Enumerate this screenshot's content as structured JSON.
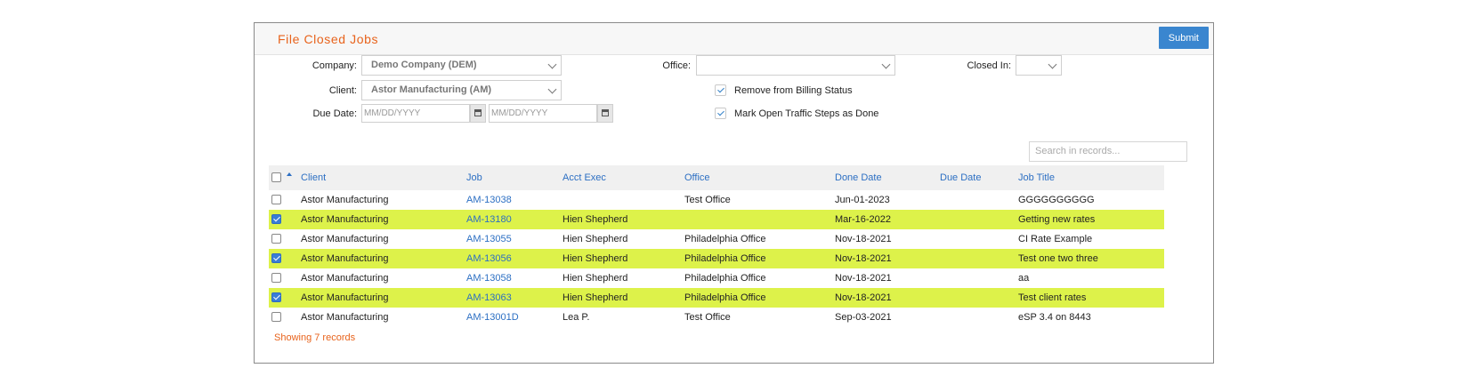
{
  "header": {
    "title": "File Closed Jobs",
    "submit_label": "Submit"
  },
  "filters": {
    "company_label": "Company:",
    "company_value": "Demo Company (DEM)",
    "client_label": "Client:",
    "client_value": "Astor Manufacturing (AM)",
    "due_date_label": "Due Date:",
    "due_from_placeholder": "MM/DD/YYYY",
    "due_to_placeholder": "MM/DD/YYYY",
    "office_label": "Office:",
    "office_value": "",
    "closed_in_label": "Closed In:",
    "closed_in_value": "",
    "remove_billing_label": "Remove from Billing Status",
    "remove_billing_checked": true,
    "mark_traffic_label": "Mark Open Traffic Steps as Done",
    "mark_traffic_checked": true
  },
  "search": {
    "placeholder": "Search in records..."
  },
  "table": {
    "columns": [
      "Client",
      "Job",
      "Acct Exec",
      "Office",
      "Done Date",
      "Due Date",
      "Job Title"
    ],
    "rows": [
      {
        "selected": false,
        "client": "Astor Manufacturing",
        "job": "AM-13038",
        "acct_exec": "",
        "office": "Test Office",
        "done_date": "Jun-01-2023",
        "due_date": "",
        "job_title": "GGGGGGGGGG"
      },
      {
        "selected": true,
        "client": "Astor Manufacturing",
        "job": "AM-13180",
        "acct_exec": "Hien Shepherd",
        "office": "",
        "done_date": "Mar-16-2022",
        "due_date": "",
        "job_title": "Getting new rates"
      },
      {
        "selected": false,
        "client": "Astor Manufacturing",
        "job": "AM-13055",
        "acct_exec": "Hien Shepherd",
        "office": "Philadelphia Office",
        "done_date": "Nov-18-2021",
        "due_date": "",
        "job_title": "CI Rate Example"
      },
      {
        "selected": true,
        "client": "Astor Manufacturing",
        "job": "AM-13056",
        "acct_exec": "Hien Shepherd",
        "office": "Philadelphia Office",
        "done_date": "Nov-18-2021",
        "due_date": "",
        "job_title": "Test one two three"
      },
      {
        "selected": false,
        "client": "Astor Manufacturing",
        "job": "AM-13058",
        "acct_exec": "Hien Shepherd",
        "office": "Philadelphia Office",
        "done_date": "Nov-18-2021",
        "due_date": "",
        "job_title": "aa"
      },
      {
        "selected": true,
        "client": "Astor Manufacturing",
        "job": "AM-13063",
        "acct_exec": "Hien Shepherd",
        "office": "Philadelphia Office",
        "done_date": "Nov-18-2021",
        "due_date": "",
        "job_title": "Test client rates"
      },
      {
        "selected": false,
        "client": "Astor Manufacturing",
        "job": "AM-13001D",
        "acct_exec": "Lea P.",
        "office": "Test Office",
        "done_date": "Sep-03-2021",
        "due_date": "",
        "job_title": "eSP 3.4 on 8443"
      }
    ]
  },
  "footer": {
    "records_text": "Showing 7 records"
  },
  "colors": {
    "accent": "#e8631c",
    "link": "#2c6fc3",
    "selected_row": "#ddf24a",
    "submit": "#3a86cf"
  }
}
